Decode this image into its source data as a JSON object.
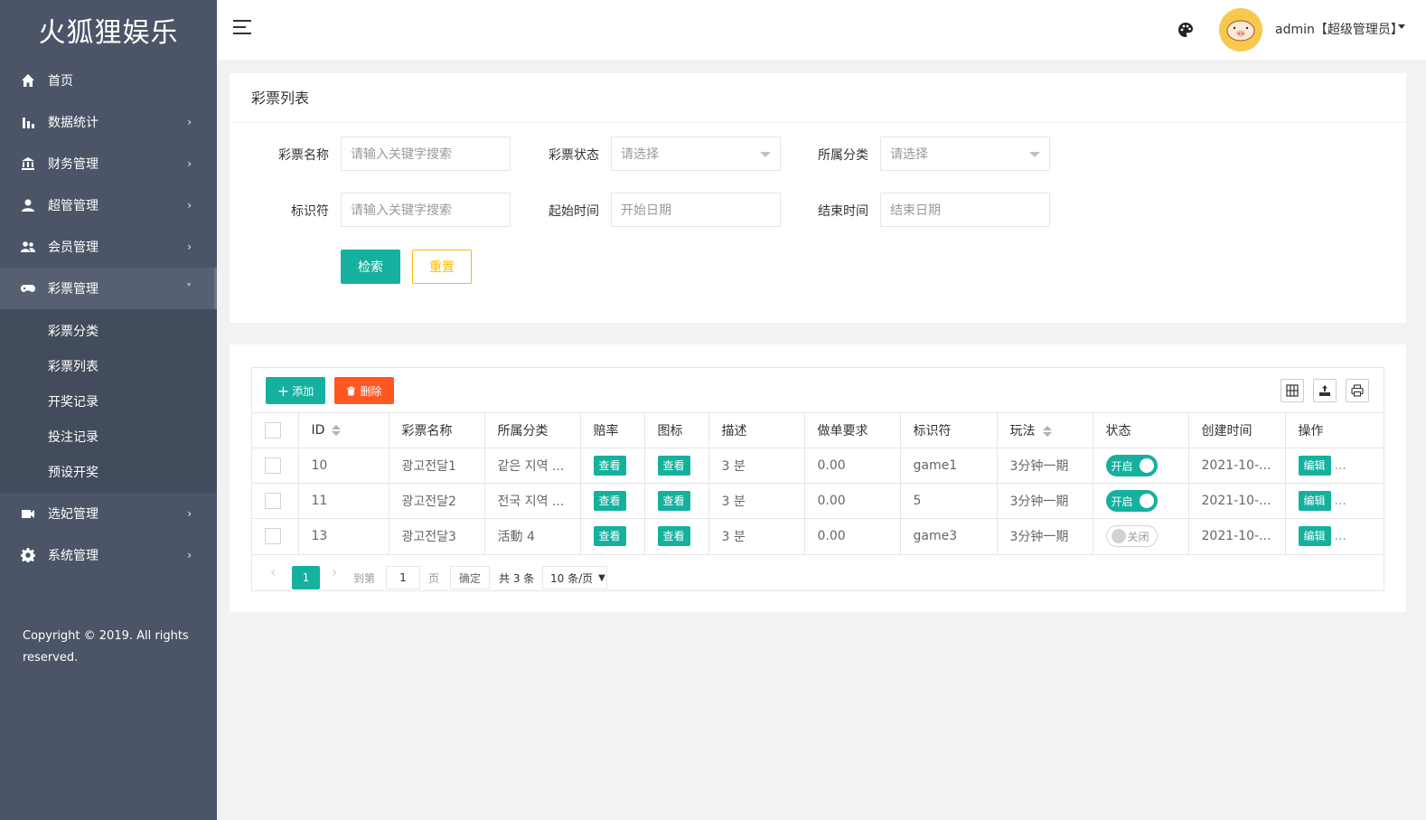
{
  "brand": "火狐狸娱乐",
  "sidebar": {
    "items": [
      {
        "label": "首页",
        "icon": "home-icon"
      },
      {
        "label": "数据统计",
        "icon": "bar-chart-icon"
      },
      {
        "label": "财务管理",
        "icon": "bank-icon"
      },
      {
        "label": "超管管理",
        "icon": "user-icon"
      },
      {
        "label": "会员管理",
        "icon": "users-icon"
      },
      {
        "label": "彩票管理",
        "icon": "gamepad-icon"
      },
      {
        "label": "选妃管理",
        "icon": "video-icon"
      },
      {
        "label": "系统管理",
        "icon": "gear-icon"
      }
    ],
    "sub_items": [
      "彩票分类",
      "彩票列表",
      "开奖记录",
      "投注记录",
      "预设开奖"
    ],
    "copyright": "Copyright © 2019. All rights reserved."
  },
  "header": {
    "user": "admin【超级管理员】"
  },
  "search": {
    "title": "彩票列表",
    "labels": {
      "name": "彩票名称",
      "status": "彩票状态",
      "category": "所属分类",
      "identifier": "标识符",
      "start": "起始时间",
      "end": "结束时间"
    },
    "placeholders": {
      "name": "请输入关键字搜索",
      "status": "请选择",
      "category": "请选择",
      "identifier": "请输入关键字搜索",
      "start": "开始日期",
      "end": "结束日期"
    },
    "search_btn": "检索",
    "reset_btn": "重置"
  },
  "toolbar": {
    "add": "添加",
    "delete": "删除"
  },
  "table": {
    "columns": [
      "ID",
      "彩票名称",
      "所属分类",
      "赔率",
      "图标",
      "描述",
      "做单要求",
      "标识符",
      "玩法",
      "状态",
      "创建时间",
      "操作"
    ],
    "rows": [
      {
        "id": "10",
        "name": "광고전달1",
        "category": "같은 지역 ...",
        "odds": "查看",
        "icon": "查看",
        "desc": "3 분",
        "req": "0.00",
        "key": "game1",
        "play": "3分钟一期",
        "status": "开启",
        "status_on": true,
        "created": "2021-10-...",
        "op": "编辑"
      },
      {
        "id": "11",
        "name": "광고전달2",
        "category": "전국 지역 ...",
        "odds": "查看",
        "icon": "查看",
        "desc": "3 분",
        "req": "0.00",
        "key": "5",
        "play": "3分钟一期",
        "status": "开启",
        "status_on": true,
        "created": "2021-10-...",
        "op": "编辑"
      },
      {
        "id": "13",
        "name": "광고전달3",
        "category": "活動 4",
        "odds": "查看",
        "icon": "查看",
        "desc": "3 분",
        "req": "0.00",
        "key": "game3",
        "play": "3分钟一期",
        "status": "关闭",
        "status_on": false,
        "created": "2021-10-...",
        "op": "编辑"
      }
    ]
  },
  "pager": {
    "current": "1",
    "goto_label": "到第",
    "page_input": "1",
    "page_label": "页",
    "ok": "确定",
    "total": "共 3 条",
    "size": "10 条/页"
  },
  "colors": {
    "sidebar": "#4b5567",
    "primary": "#16b09e",
    "danger": "#ff5722",
    "warn": "#ffb800"
  }
}
